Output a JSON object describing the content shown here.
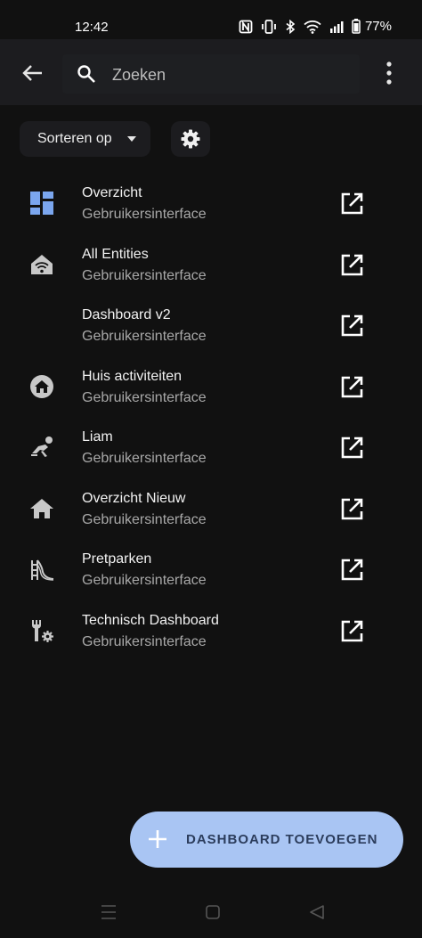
{
  "status_bar": {
    "time": "12:42",
    "battery": "77%",
    "icons": [
      "nfc-icon",
      "vibrate-icon",
      "bluetooth-icon",
      "wifi-icon",
      "signal-icon",
      "battery-icon"
    ]
  },
  "app_bar": {
    "back_icon": "arrow-left-icon",
    "search": {
      "placeholder": "Zoeken",
      "value": ""
    },
    "menu_icon": "dots-vertical-icon"
  },
  "toolbar": {
    "sort_label": "Sorteren op",
    "sort_icon": "caret-down-icon",
    "settings_icon": "gear-icon"
  },
  "dashboards": [
    {
      "title": "Overzicht",
      "subtitle": "Gebruikersinterface",
      "icon": "view-dashboard-icon",
      "icon_color": "#7ba6ee"
    },
    {
      "title": "All Entities",
      "subtitle": "Gebruikersinterface",
      "icon": "home-wifi-icon",
      "icon_color": "#c8c8c8"
    },
    {
      "title": "Dashboard v2",
      "subtitle": "Gebruikersinterface",
      "icon": "",
      "icon_color": ""
    },
    {
      "title": "Huis activiteiten",
      "subtitle": "Gebruikersinterface",
      "icon": "home-circle-icon",
      "icon_color": "#c8c8c8"
    },
    {
      "title": "Liam",
      "subtitle": "Gebruikersinterface",
      "icon": "person-crawling-icon",
      "icon_color": "#c8c8c8"
    },
    {
      "title": "Overzicht Nieuw",
      "subtitle": "Gebruikersinterface",
      "icon": "home-icon",
      "icon_color": "#c8c8c8"
    },
    {
      "title": "Pretparken",
      "subtitle": "Gebruikersinterface",
      "icon": "slide-icon",
      "icon_color": "#c8c8c8"
    },
    {
      "title": "Technisch Dashboard",
      "subtitle": "Gebruikersinterface",
      "icon": "wrench-cog-icon",
      "icon_color": "#c8c8c8"
    }
  ],
  "open_icon": "open-in-new-icon",
  "fab": {
    "label": "DASHBOARD TOEVOEGEN",
    "icon": "plus-icon",
    "color": "#a9c5f3"
  },
  "nav_bar": {
    "icons": [
      "recents-icon",
      "home-square-icon",
      "back-triangle-icon"
    ]
  },
  "colors": {
    "background": "#111111",
    "app_bar": "#1c1c1f",
    "accent": "#7ba6ee"
  }
}
